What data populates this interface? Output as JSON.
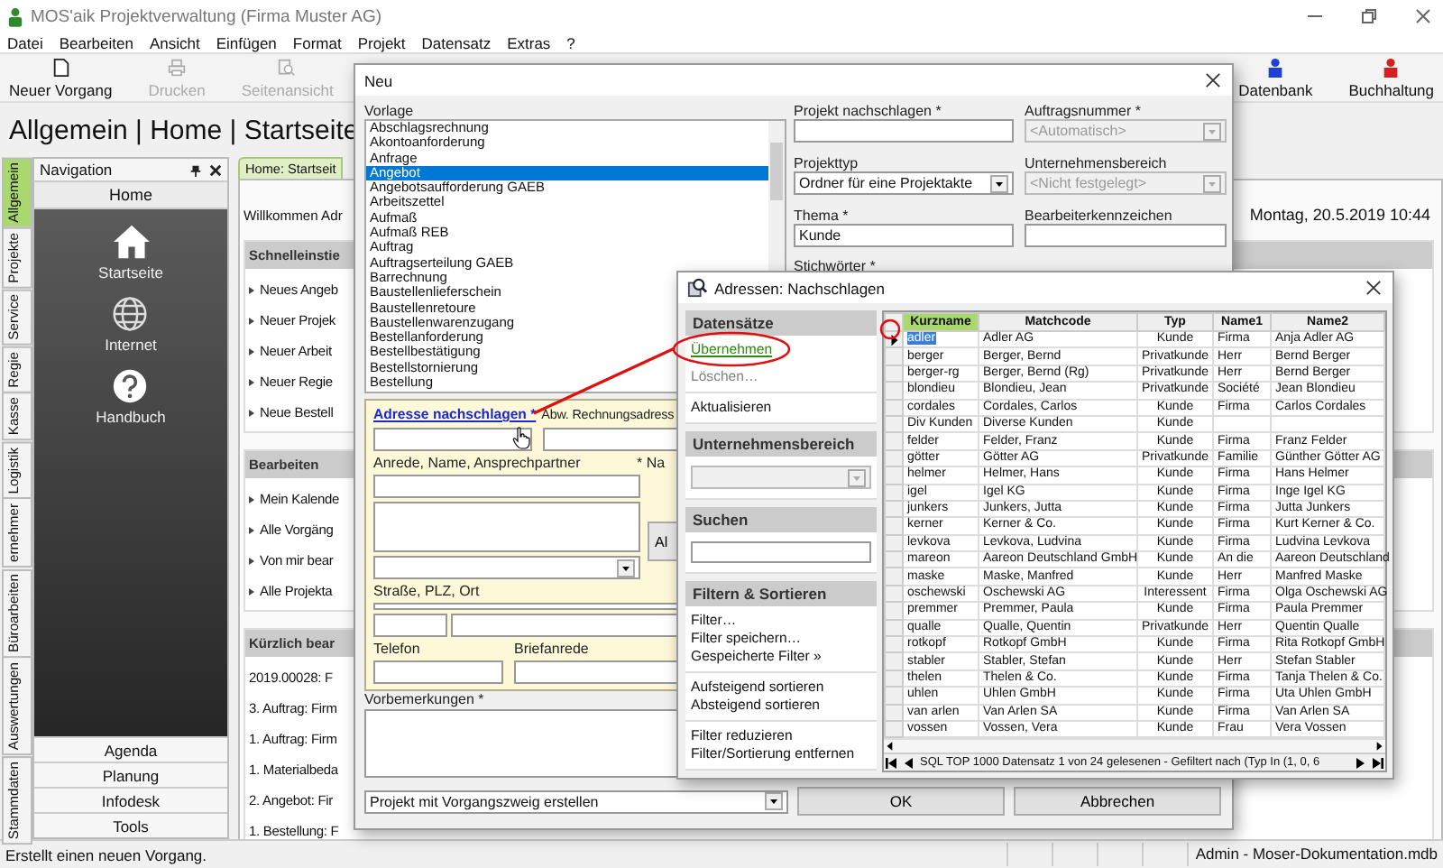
{
  "window": {
    "title": "MOS'aik Projektverwaltung (Firma Muster AG)"
  },
  "menu": [
    "Datei",
    "Bearbeiten",
    "Ansicht",
    "Einfügen",
    "Format",
    "Projekt",
    "Datensatz",
    "Extras",
    "?"
  ],
  "toolbar": [
    {
      "label": "Neuer Vorgang",
      "kind": "new",
      "disabled": false
    },
    {
      "label": "Drucken",
      "kind": "print",
      "disabled": true
    },
    {
      "label": "Seitenansicht",
      "kind": "preview",
      "disabled": true
    }
  ],
  "toolbar_right": [
    {
      "label": "Datenbank",
      "color": "#1f3fd6"
    },
    {
      "label": "Buchhaltung",
      "color": "#d61f1f"
    }
  ],
  "breadcrumb": "Allgemein | Home | Startseite",
  "side_tabs": [
    {
      "label": "Allgemein",
      "selected": true
    },
    {
      "label": "Projekte",
      "selected": false
    },
    {
      "label": "Service",
      "selected": false
    },
    {
      "label": "Regie",
      "selected": false
    },
    {
      "label": "Kasse",
      "selected": false
    },
    {
      "label": "Logistik",
      "selected": false
    },
    {
      "label": "ernehmer",
      "selected": false
    },
    {
      "label": "Büroarbeiten",
      "selected": false
    },
    {
      "label": "Auswertungen",
      "selected": false
    },
    {
      "label": "Stammdaten",
      "selected": false
    }
  ],
  "navigation": {
    "title": "Navigation",
    "section": "Home",
    "items": [
      {
        "label": "Startseite",
        "kind": "home"
      },
      {
        "label": "Internet",
        "kind": "globe"
      },
      {
        "label": "Handbuch",
        "kind": "help"
      }
    ],
    "groups": [
      "Agenda",
      "Planung",
      "Infodesk",
      "Tools"
    ]
  },
  "content": {
    "tab": "Home: Startseit",
    "welcome": "Willkommen Adr",
    "date": "Montag, 20.5.2019 10:44",
    "sections": [
      {
        "title": "Schnelleinstie",
        "kind": "links",
        "items": [
          "Neues Angeb",
          "Neuer Projek",
          "Neuer Arbeit",
          "Neuer Regie",
          "Neue Bestell"
        ]
      },
      {
        "title": "Bearbeiten",
        "kind": "links",
        "items": [
          "Mein Kalende",
          "Alle Vorgäng",
          "Von mir bear",
          "Alle Projekta"
        ]
      },
      {
        "title": "Kürzlich bear",
        "kind": "recent",
        "items": [
          "2019.00028: F",
          "3. Auftrag: Firm",
          "1. Auftrag: Firm",
          "1. Materialbeda",
          "2. Angebot: Fir",
          "1. Bestellung: F"
        ]
      }
    ]
  },
  "new_dialog": {
    "title": "Neu",
    "template_label": "Vorlage",
    "templates": [
      {
        "label": "Abschlagsrechnung",
        "selected": false
      },
      {
        "label": "Akontoanforderung",
        "selected": false
      },
      {
        "label": "Anfrage",
        "selected": false
      },
      {
        "label": "Angebot",
        "selected": true
      },
      {
        "label": "Angebotsaufforderung GAEB",
        "selected": false
      },
      {
        "label": "Arbeitszettel",
        "selected": false
      },
      {
        "label": "Aufmaß",
        "selected": false
      },
      {
        "label": "Aufmaß REB",
        "selected": false
      },
      {
        "label": "Auftrag",
        "selected": false
      },
      {
        "label": "Auftragserteilung GAEB",
        "selected": false
      },
      {
        "label": "Barrechnung",
        "selected": false
      },
      {
        "label": "Baustellenlieferschein",
        "selected": false
      },
      {
        "label": "Baustellenretoure",
        "selected": false
      },
      {
        "label": "Baustellenwarenzugang",
        "selected": false
      },
      {
        "label": "Bestellanforderung",
        "selected": false
      },
      {
        "label": "Bestellbestätigung",
        "selected": false
      },
      {
        "label": "Bestellstornierung",
        "selected": false
      },
      {
        "label": "Bestellung",
        "selected": false
      }
    ],
    "fields": [
      {
        "label": "Projekt nachschlagen *",
        "kind": "input"
      },
      {
        "label": "Auftragsnummer *",
        "kind": "select",
        "value": "<Automatisch>",
        "disabled": true
      },
      {
        "label": "Projekttyp",
        "kind": "select",
        "value": "Ordner für eine Projektakte",
        "disabled": false
      },
      {
        "label": "Unternehmensbereich",
        "kind": "select",
        "value": "<Nicht festgelegt>",
        "disabled": true
      },
      {
        "label": "Thema *",
        "kind": "input",
        "value": "Kunde"
      },
      {
        "label": "Bearbeiterkennzeichen",
        "kind": "input"
      }
    ],
    "keywords_label": "Stichwörter *",
    "address": {
      "lookup_link": "Adresse nachschlagen *",
      "alt_label": "Abw. Rechnungsadress",
      "name_label": "Anrede, Name, Ansprechpartner",
      "name2_label": "* Na",
      "button": "Al",
      "street_label": "Straße, PLZ, Ort",
      "phone_label": "Telefon",
      "salutation_label": "Briefanrede"
    },
    "remarks_label": "Vorbemerkungen *",
    "mode": "Projekt mit Vorgangszweig erstellen",
    "buttons": [
      "OK",
      "Abbrechen"
    ]
  },
  "lookup_dialog": {
    "title": "Adressen: Nachschlagen",
    "panel": [
      {
        "title": "Datensätze",
        "kind": "actions",
        "groups": [
          [
            {
              "label": "Übernehmen",
              "hovered": true,
              "disabled": false
            },
            {
              "label": "Löschen…",
              "hovered": false,
              "disabled": true
            }
          ],
          [
            {
              "label": "Aktualisieren",
              "hovered": false,
              "disabled": false
            }
          ]
        ]
      },
      {
        "title": "Unternehmensbereich",
        "kind": "select"
      },
      {
        "title": "Suchen",
        "kind": "search"
      },
      {
        "title": "Filtern & Sortieren",
        "kind": "actions",
        "groups": [
          [
            {
              "label": "Filter…",
              "hovered": false,
              "disabled": false
            },
            {
              "label": "Filter speichern…",
              "hovered": false,
              "disabled": false
            },
            {
              "label": "Gespeicherte Filter »",
              "hovered": false,
              "disabled": false
            }
          ],
          [
            {
              "label": "Aufsteigend sortieren",
              "hovered": false,
              "disabled": false
            },
            {
              "label": "Absteigend sortieren",
              "hovered": false,
              "disabled": false
            }
          ],
          [
            {
              "label": "Filter reduzieren",
              "hovered": false,
              "disabled": false
            },
            {
              "label": "Filter/Sortierung entfernen",
              "hovered": false,
              "disabled": false
            }
          ]
        ]
      }
    ],
    "table": {
      "columns": [
        {
          "label": "Kurzname",
          "selected": true
        },
        {
          "label": "Matchcode",
          "selected": false
        },
        {
          "label": "Typ",
          "selected": false
        },
        {
          "label": "Name1",
          "selected": false
        },
        {
          "label": "Name2",
          "selected": false
        }
      ],
      "rows": [
        {
          "short_name": "adler",
          "matchcode": "Adler AG",
          "type": "Kunde",
          "name1": "Firma",
          "name2": "Anja Adler AG",
          "selected": true
        },
        {
          "short_name": "berger",
          "matchcode": "Berger, Bernd",
          "type": "Privatkunde",
          "name1": "Herr",
          "name2": "Bernd Berger",
          "selected": false
        },
        {
          "short_name": "berger-rg",
          "matchcode": "Berger, Bernd (Rg)",
          "type": "Privatkunde",
          "name1": "Herr",
          "name2": "Bernd Berger",
          "selected": false
        },
        {
          "short_name": "blondieu",
          "matchcode": "Blondieu, Jean",
          "type": "Privatkunde",
          "name1": "Société",
          "name2": "Jean Blondieu",
          "selected": false
        },
        {
          "short_name": "cordales",
          "matchcode": "Cordales, Carlos",
          "type": "Kunde",
          "name1": "Firma",
          "name2": "Carlos Cordales",
          "selected": false
        },
        {
          "short_name": "Div Kunden",
          "matchcode": "Diverse Kunden",
          "type": "Kunde",
          "selected": false
        },
        {
          "short_name": "felder",
          "matchcode": "Felder, Franz",
          "type": "Kunde",
          "name1": "Firma",
          "name2": "Franz Felder",
          "selected": false
        },
        {
          "short_name": "götter",
          "matchcode": "Götter AG",
          "type": "Privatkunde",
          "name1": "Familie",
          "name2": "Günther Götter AG",
          "selected": false
        },
        {
          "short_name": "helmer",
          "matchcode": "Helmer, Hans",
          "type": "Kunde",
          "name1": "Firma",
          "name2": "Hans Helmer",
          "selected": false
        },
        {
          "short_name": "igel",
          "matchcode": "Igel KG",
          "type": "Kunde",
          "name1": "Firma",
          "name2": "Inge Igel KG",
          "selected": false
        },
        {
          "short_name": "junkers",
          "matchcode": "Junkers, Jutta",
          "type": "Kunde",
          "name1": "Firma",
          "name2": "Jutta Junkers",
          "selected": false
        },
        {
          "short_name": "kerner",
          "matchcode": "Kerner & Co.",
          "type": "Kunde",
          "name1": "Firma",
          "name2": "Kurt Kerner & Co.",
          "selected": false
        },
        {
          "short_name": "levkova",
          "matchcode": "Levkova, Ludvina",
          "type": "Kunde",
          "name1": "Firma",
          "name2": "Ludvina Levkova",
          "selected": false
        },
        {
          "short_name": "mareon",
          "matchcode": "Aareon Deutschland GmbH",
          "type": "Kunde",
          "name1": "An die",
          "name2": "Aareon Deutschland",
          "selected": false
        },
        {
          "short_name": "maske",
          "matchcode": "Maske, Manfred",
          "type": "Kunde",
          "name1": "Herr",
          "name2": "Manfred Maske",
          "selected": false
        },
        {
          "short_name": "oschewski",
          "matchcode": "Oschewski AG",
          "type": "Interessent",
          "name1": "Firma",
          "name2": "Olga Oschewski AG",
          "selected": false
        },
        {
          "short_name": "premmer",
          "matchcode": "Premmer, Paula",
          "type": "Kunde",
          "name1": "Firma",
          "name2": "Paula Premmer",
          "selected": false
        },
        {
          "short_name": "qualle",
          "matchcode": "Qualle, Quentin",
          "type": "Privatkunde",
          "name1": "Herr",
          "name2": "Quentin Qualle",
          "selected": false
        },
        {
          "short_name": "rotkopf",
          "matchcode": "Rotkopf GmbH",
          "type": "Kunde",
          "name1": "Firma",
          "name2": "Rita Rotkopf GmbH",
          "selected": false
        },
        {
          "short_name": "stabler",
          "matchcode": "Stabler, Stefan",
          "type": "Kunde",
          "name1": "Herr",
          "name2": "Stefan Stabler",
          "selected": false
        },
        {
          "short_name": "thelen",
          "matchcode": "Thelen & Co.",
          "type": "Kunde",
          "name1": "Firma",
          "name2": "Tanja Thelen & Co.",
          "selected": false
        },
        {
          "short_name": "uhlen",
          "matchcode": "Uhlen GmbH",
          "type": "Kunde",
          "name1": "Firma",
          "name2": "Uta Uhlen GmbH",
          "selected": false
        },
        {
          "short_name": "van arlen",
          "matchcode": "Van Arlen SA",
          "type": "Kunde",
          "name1": "Firma",
          "name2": "Van Arlen SA",
          "selected": false
        },
        {
          "short_name": "vossen",
          "matchcode": "Vossen, Vera",
          "type": "Kunde",
          "name1": "Frau",
          "name2": "Vera Vossen",
          "selected": false
        }
      ],
      "status": "SQL TOP 1000 Datensatz 1 von 24 gelesenen - Gefiltert nach (Typ In (1, 0, 6"
    }
  },
  "status_bar": {
    "message": "Erstellt einen neuen Vorgang.",
    "database": "Admin - Moser-Dokumentation.mdb"
  }
}
